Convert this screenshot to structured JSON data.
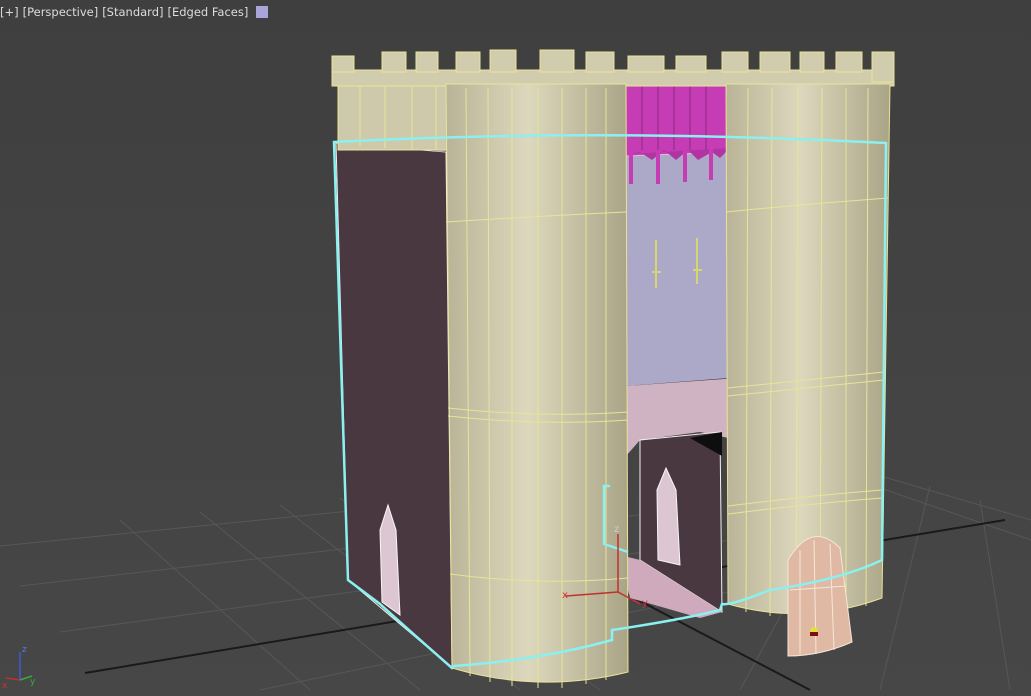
{
  "viewport": {
    "labels": {
      "menu": "[+]",
      "point_of_view": "[Perspective]",
      "shading": "[Standard]",
      "edged_faces": "[Edged Faces]"
    },
    "swatch_color": "#a9a4dc"
  },
  "gizmo": {
    "x": "x",
    "y": "y",
    "z": "z"
  },
  "view_axis": {
    "x": "x",
    "y": "y",
    "z": "z"
  },
  "colors": {
    "background": "#444444",
    "grid": "#555555",
    "selection_outline": "#8af0f0",
    "tower_fill": "#d2ccae",
    "wire": "#e9e39a",
    "dark_wall": "#4a3840",
    "light_wall": "#a9a6c8",
    "banner": "#c63cb5",
    "gate_floor": "#c9a9b8",
    "door": "#e0b9a4"
  }
}
